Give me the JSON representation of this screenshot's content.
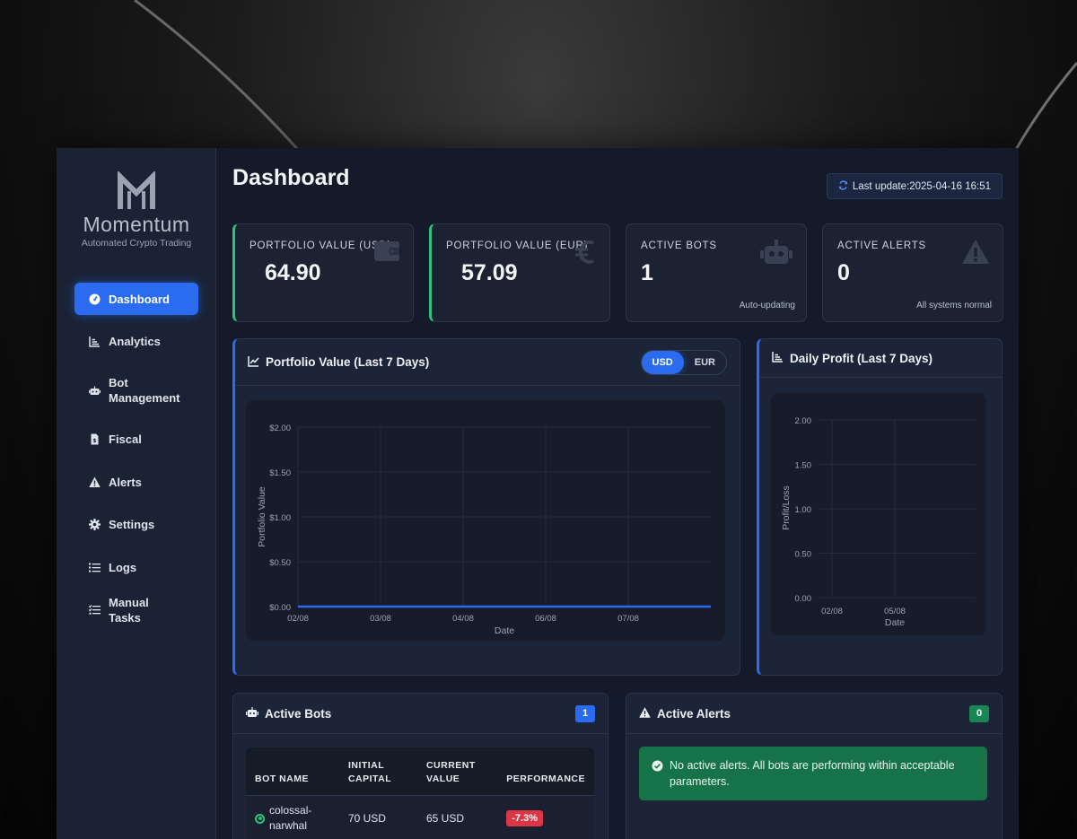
{
  "brand": {
    "name": "Momentum",
    "tagline": "Automated Crypto Trading"
  },
  "sidebar": {
    "items": [
      {
        "label": "Dashboard",
        "icon": "gauge-icon",
        "active": true
      },
      {
        "label": "Analytics",
        "icon": "chart-icon"
      },
      {
        "label": "Bot Management",
        "icon": "robot-icon"
      },
      {
        "label": "Fiscal",
        "icon": "invoice-icon"
      },
      {
        "label": "Alerts",
        "icon": "warning-icon"
      },
      {
        "label": "Settings",
        "icon": "gear-icon"
      },
      {
        "label": "Logs",
        "icon": "list-icon"
      },
      {
        "label": "Manual Tasks",
        "icon": "tasks-icon"
      }
    ]
  },
  "header": {
    "title": "Dashboard",
    "last_update": "Last update:2025-04-16 16:51"
  },
  "stats": [
    {
      "label": "PORTFOLIO VALUE (USD)",
      "value": "64.90",
      "sub": "",
      "icon": "wallet-icon"
    },
    {
      "label": "PORTFOLIO VALUE (EUR)",
      "value": "57.09",
      "sub": "",
      "icon": "euro-icon"
    },
    {
      "label": "ACTIVE BOTS",
      "value": "1",
      "sub": "Auto-updating",
      "icon": "robot-icon"
    },
    {
      "label": "ACTIVE ALERTS",
      "value": "0",
      "sub": "All systems normal",
      "icon": "warning-icon"
    }
  ],
  "portfolio_chart": {
    "title": "Portfolio Value (Last 7 Days)",
    "toggle": {
      "usd": "USD",
      "eur": "EUR",
      "selected": "USD"
    }
  },
  "profit_chart": {
    "title": "Daily Profit (Last 7 Days)"
  },
  "active_bots": {
    "title": "Active Bots",
    "count": "1",
    "columns": [
      "BOT NAME",
      "INITIAL CAPITAL",
      "CURRENT VALUE",
      "PERFORMANCE"
    ],
    "rows": [
      {
        "name": "colossal-narwhal",
        "initial": "70 USD",
        "current": "65 USD",
        "performance": "-7.3%"
      }
    ]
  },
  "active_alerts": {
    "title": "Active Alerts",
    "count": "0",
    "message": "No active alerts. All bots are performing within acceptable parameters."
  },
  "chart_data": [
    {
      "type": "line",
      "title": "",
      "xlabel": "Date",
      "ylabel": "Portfolio Value",
      "x": [
        "02/08",
        "03/08",
        "04/08",
        "06/08",
        "07/08"
      ],
      "ylim": [
        0,
        2
      ],
      "yticks": [
        "$0.00",
        "$0.50",
        "$1.00",
        "$1.50",
        "$2.00"
      ],
      "series": [
        {
          "values": [
            0,
            0,
            0,
            0,
            0,
            0
          ],
          "color": "#2a6bf0"
        }
      ],
      "grid": true
    },
    {
      "type": "bar",
      "title": "",
      "xlabel": "Date",
      "ylabel": "Profit/Loss",
      "categories": [
        "02/08",
        "05/08"
      ],
      "values": [
        0,
        0
      ],
      "ylim": [
        0,
        2
      ],
      "yticks": [
        "0.00",
        "0.50",
        "1.00",
        "1.50",
        "2.00"
      ],
      "grid": true
    }
  ]
}
